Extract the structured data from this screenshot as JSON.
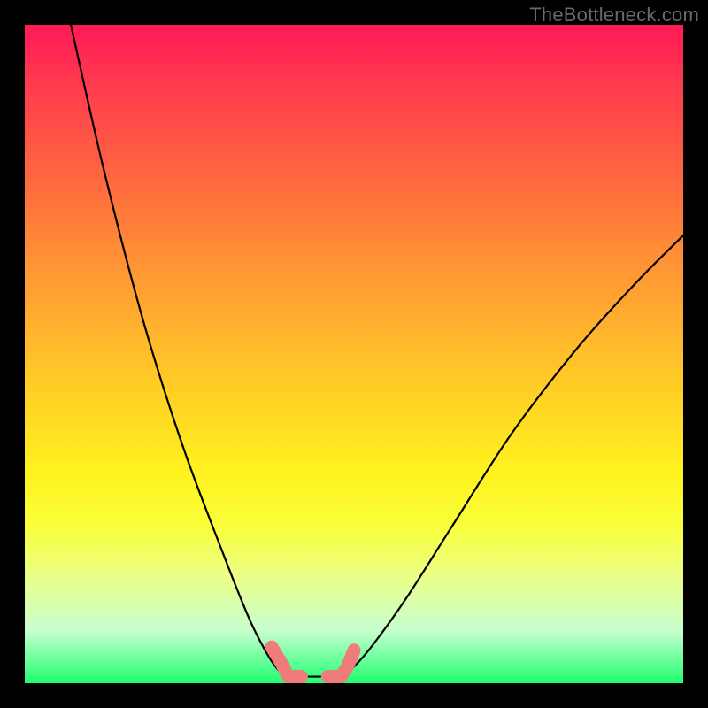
{
  "watermark": "TheBottleneck.com",
  "chart_data": {
    "type": "line",
    "title": "",
    "xlabel": "",
    "ylabel": "",
    "xlim": [
      0,
      100
    ],
    "ylim": [
      0,
      100
    ],
    "grid": false,
    "legend": false,
    "background_gradient": {
      "direction": "vertical",
      "stops": [
        {
          "pos": 0.0,
          "color": "#ff1a57"
        },
        {
          "pos": 0.68,
          "color": "#fff21f"
        },
        {
          "pos": 1.0,
          "color": "#1eff70"
        }
      ]
    },
    "series": [
      {
        "name": "left-curve",
        "color": "#000000",
        "x": [
          7.0,
          12.0,
          18.0,
          24.0,
          30.0,
          34.0,
          36.5,
          38.5,
          40.0
        ],
        "y": [
          100.0,
          78.0,
          55.0,
          36.0,
          20.0,
          10.0,
          5.0,
          2.0,
          1.0
        ]
      },
      {
        "name": "right-curve",
        "color": "#000000",
        "x": [
          48.0,
          50.0,
          53.0,
          58.0,
          65.0,
          74.0,
          84.0,
          93.0,
          100.0
        ],
        "y": [
          1.0,
          2.5,
          6.0,
          13.0,
          24.0,
          38.0,
          51.0,
          61.0,
          68.0
        ]
      },
      {
        "name": "valley-floor",
        "color": "#000000",
        "x": [
          40.0,
          48.0
        ],
        "y": [
          1.0,
          1.0
        ]
      },
      {
        "name": "pink-markers-left",
        "color": "#ef7b7b",
        "stroke_width": 14,
        "x": [
          37.5,
          39.0,
          40.0,
          41.0,
          42.0
        ],
        "y": [
          5.5,
          3.0,
          1.0,
          1.0,
          1.0
        ]
      },
      {
        "name": "pink-markers-right",
        "color": "#ef7b7b",
        "stroke_width": 14,
        "x": [
          46.0,
          47.0,
          48.0,
          49.0,
          50.0
        ],
        "y": [
          1.0,
          1.0,
          1.0,
          2.5,
          5.0
        ]
      }
    ]
  }
}
